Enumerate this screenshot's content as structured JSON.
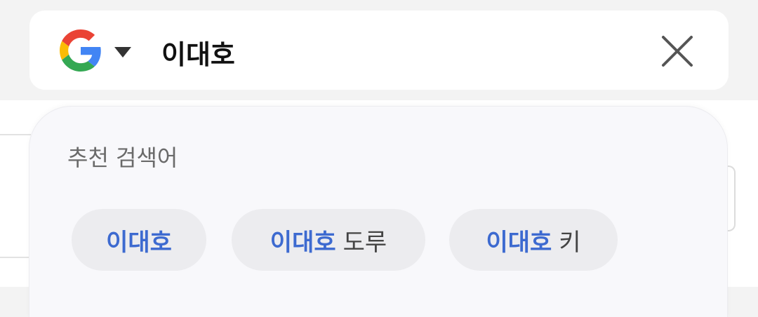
{
  "search": {
    "query": "이대호",
    "provider_icon": "google-g-icon",
    "dropdown_icon": "caret-down-icon",
    "clear_icon": "close-icon"
  },
  "suggestions": {
    "title": "추천 검색어",
    "items": [
      {
        "highlight": "이대호",
        "rest": ""
      },
      {
        "highlight": "이대호",
        "rest": "도루"
      },
      {
        "highlight": "이대호",
        "rest": "키"
      }
    ]
  },
  "colors": {
    "highlight": "#3d6ad0",
    "chip_bg": "#ececef",
    "panel_bg": "#f8f8fb"
  }
}
